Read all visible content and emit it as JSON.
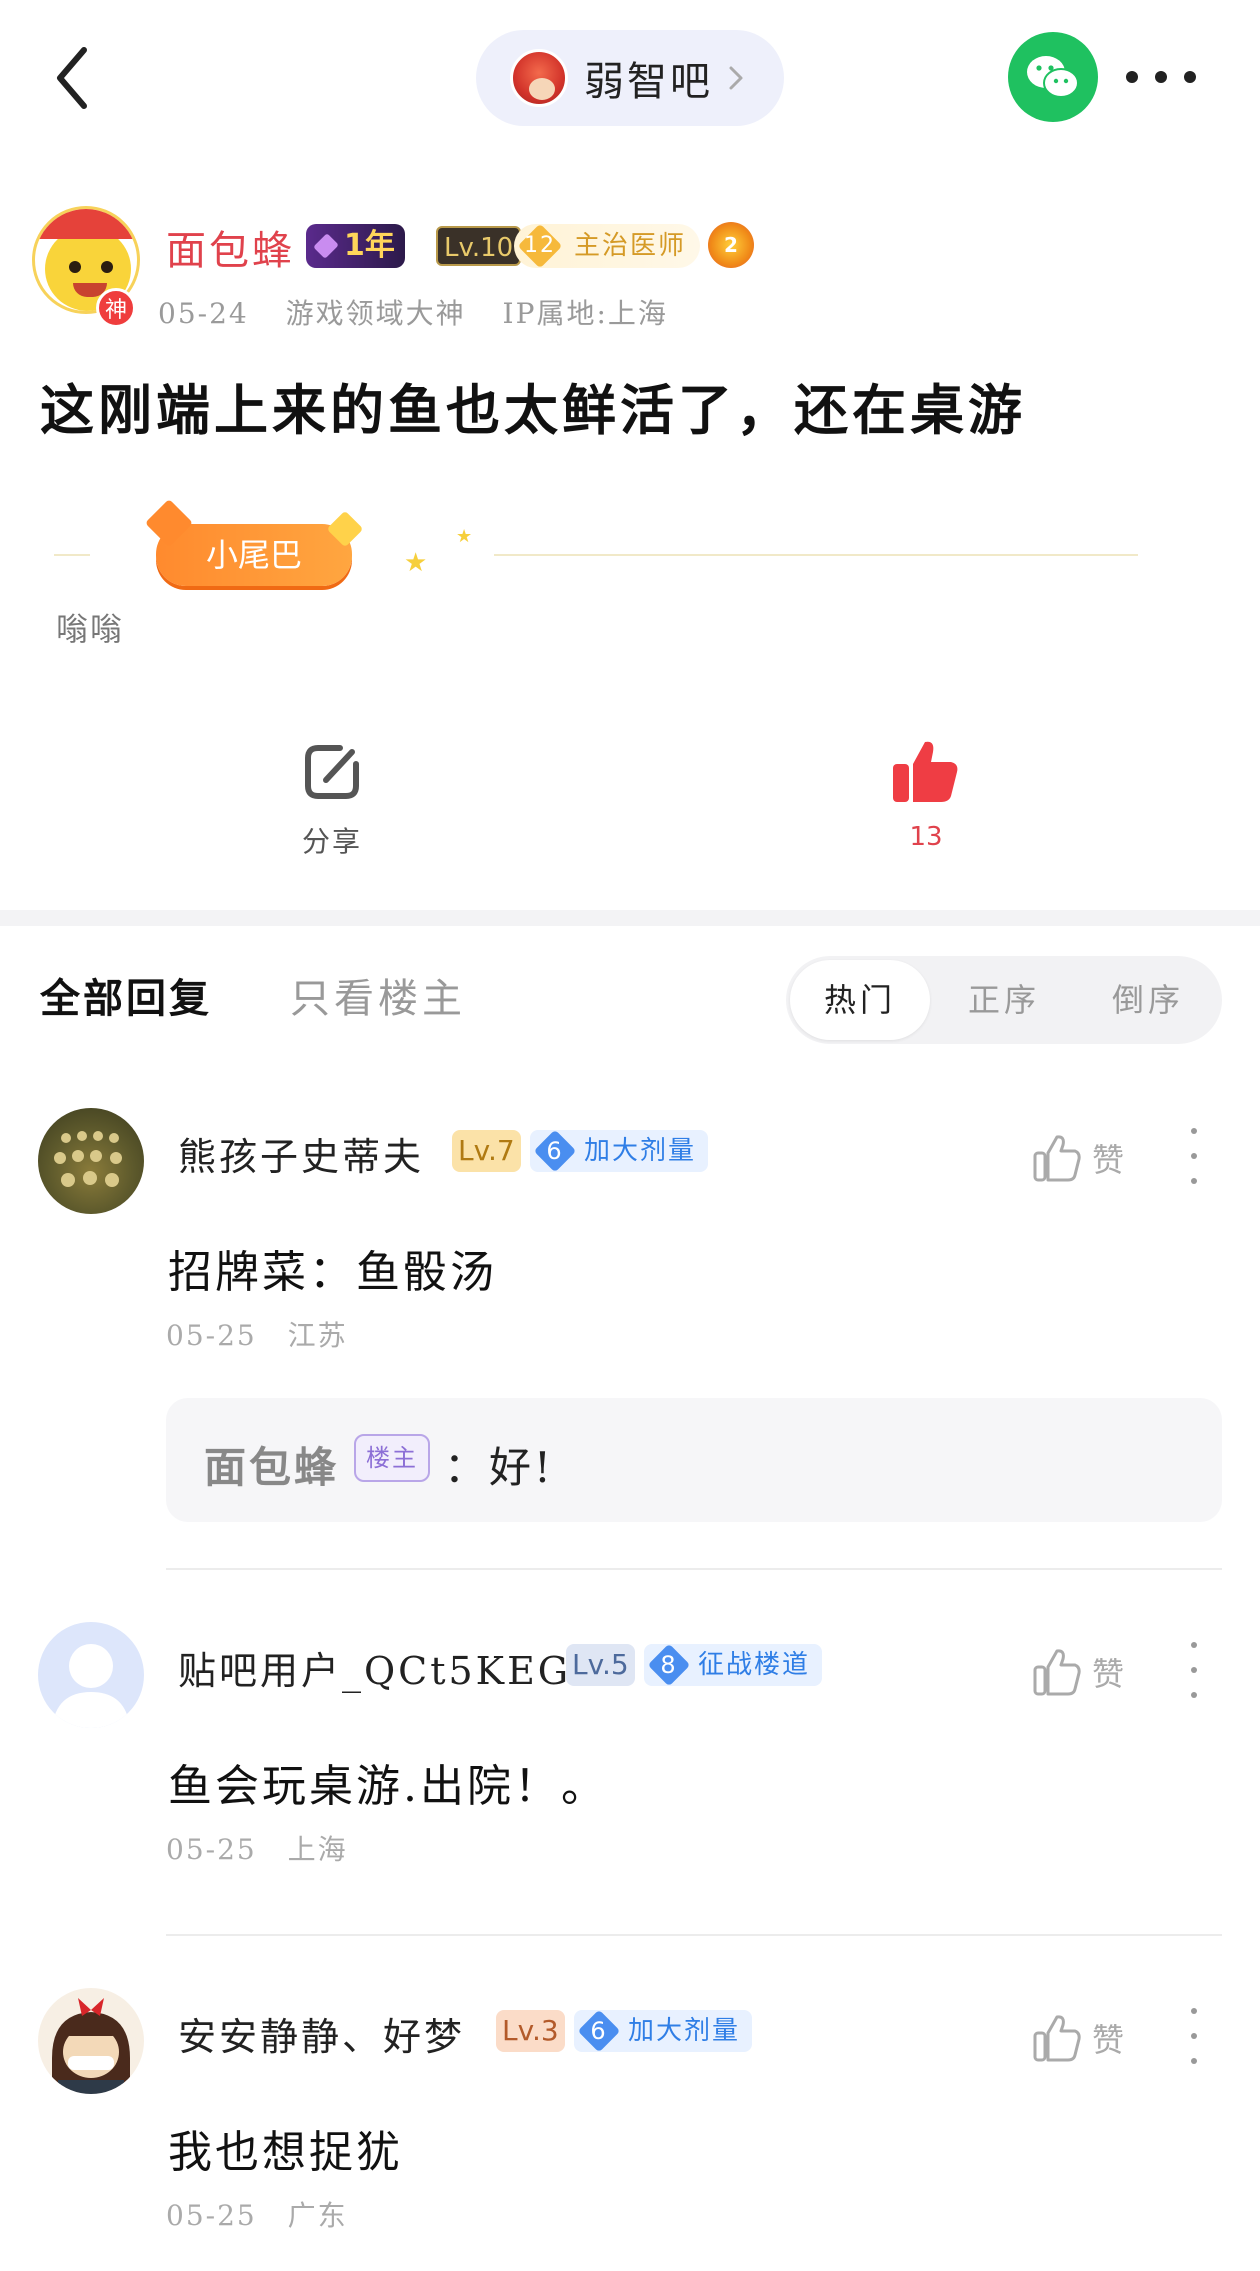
{
  "header": {
    "forum_name": "弱智吧"
  },
  "author": {
    "name": "面包蜂",
    "badge_year": "1年",
    "level": "Lv.10",
    "title_level": "12",
    "title": "主治医师",
    "extra_badge": "2",
    "avatar_badge": "神",
    "date": "05-24",
    "role": "游戏领域大神",
    "ip": "IP属地:上海"
  },
  "post": {
    "title": "这刚端上来的鱼也太鲜活了，还在桌游",
    "tail_tag": "小尾巴",
    "tail_text": "嗡嗡"
  },
  "actions": {
    "share_label": "分享",
    "like_count": "13"
  },
  "replies_header": {
    "tab_all": "全部回复",
    "tab_op": "只看楼主",
    "sort_hot": "热门",
    "sort_asc": "正序",
    "sort_desc": "倒序"
  },
  "replies": [
    {
      "name": "熊孩子史蒂夫",
      "level": "Lv.7",
      "medal_level": "6",
      "medal": "加大剂量",
      "content": "招牌菜：鱼骰汤",
      "date": "05-25",
      "location": "江苏",
      "like_label": "赞",
      "sub_reply": {
        "name": "面包蜂",
        "op_tag": "楼主",
        "text": "：好!"
      }
    },
    {
      "name": "贴吧用户_QCt5KEG",
      "level": "Lv.5",
      "medal_level": "8",
      "medal": "征战楼道",
      "content": "鱼会玩桌游.出院！。",
      "date": "05-25",
      "location": "上海",
      "like_label": "赞"
    },
    {
      "name": "安安静静、好梦",
      "level": "Lv.3",
      "medal_level": "6",
      "medal": "加大剂量",
      "content": "我也想捉犹",
      "date": "05-25",
      "location": "广东",
      "like_label": "赞"
    }
  ],
  "colors": {
    "accent_red": "#e0424c",
    "wechat_green": "#1fc160",
    "medal_blue": "#2f7ee6"
  }
}
